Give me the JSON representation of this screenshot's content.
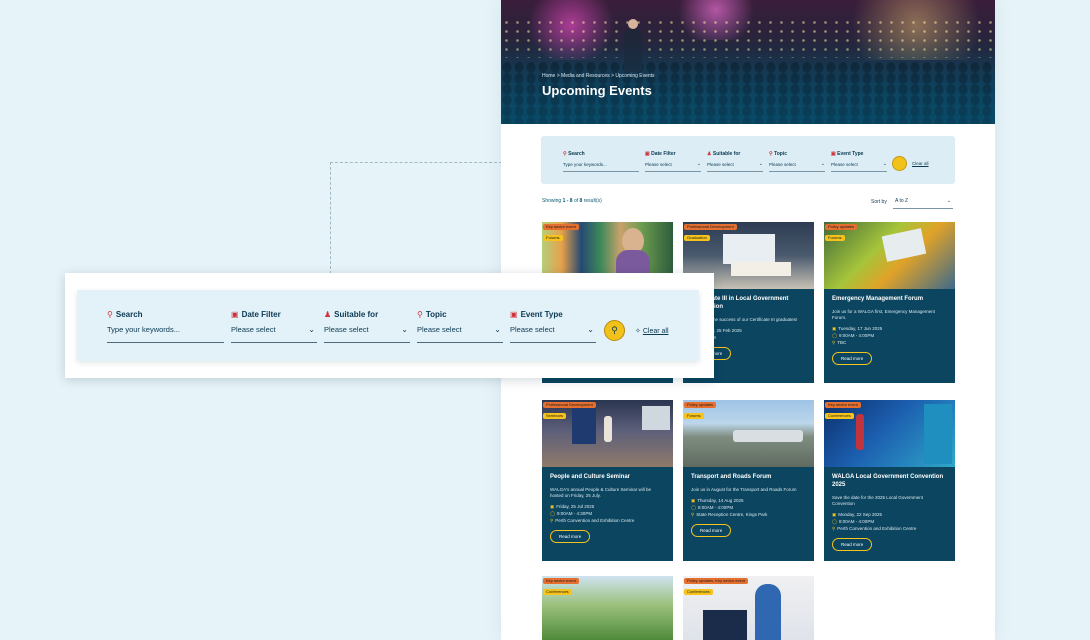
{
  "hero": {
    "breadcrumb": "Home > Media and Resources > Upcoming Events",
    "title": "Upcoming Events"
  },
  "filter": {
    "search_label": "Search",
    "search_placeholder": "Type your keywords...",
    "date_label": "Date Filter",
    "suitable_label": "Suitable for",
    "topic_label": "Topic",
    "type_label": "Event Type",
    "select_placeholder": "Please select",
    "clear_label": "Clear all"
  },
  "results": {
    "prefix": "Showing",
    "range": "1 - 8",
    "of": "of",
    "total": "8",
    "suffix": "result(s)",
    "sort_label": "Sort by",
    "sort_value": "A to Z"
  },
  "cards": [
    {
      "tag1": "Key sector event",
      "tag2": "Forums",
      "title": "",
      "desc": "",
      "date": "",
      "time": "",
      "place": "",
      "btn": "Read more"
    },
    {
      "tag1": "Professional Development",
      "tag2": "Graduation",
      "title": "Certificate III in Local Government Graduation",
      "desc": "Celebrate the success of our Certificate III graduates!",
      "date": "Tuesday, 25 Feb 2025",
      "time": "11:00AM",
      "place": "",
      "btn": "Read more"
    },
    {
      "tag1": "Policy updates",
      "tag2": "Forums",
      "title": "Emergency Management Forum",
      "desc": "Join us for a WALGA first, Emergency Management Forum.",
      "date": "Tuesday, 17 Jun 2025",
      "time": "9:00AM - 4:00PM",
      "place": "TBC",
      "btn": "Read more"
    },
    {
      "tag1": "Professional Development",
      "tag2": "Seminars",
      "title": "People and Culture Seminar",
      "desc": "WALGA's annual People & Culture Seminar will be hosted on Friday, 25 July.",
      "date": "Friday, 25 Jul 2025",
      "time": "9:00AM - 4:30PM",
      "place": "Perth Convention and Exhibition Centre",
      "btn": "Read more"
    },
    {
      "tag1": "Policy updates",
      "tag2": "Forums",
      "title": "Transport and Roads Forum",
      "desc": "Join us in August for the Transport and Roads Forum",
      "date": "Thursday, 14 Aug 2025",
      "time": "8:00AM - 4:00PM",
      "place": "State Reception Centre, Kings Park",
      "btn": "Read more"
    },
    {
      "tag1": "Key sector event",
      "tag2": "Conferences",
      "title": "WALGA Local Government Convention 2025",
      "desc": "Save the date for the 2025 Local Government Convention",
      "date": "Monday, 22 Sep 2025",
      "time": "8:00AM - 4:00PM",
      "place": "Perth Convention and Exhibition Centre",
      "btn": "Read more"
    },
    {
      "tag1": "Key sector event",
      "tag2": "Conferences"
    },
    {
      "tag1": "Policy updates, Key sector event",
      "tag2": "Conferences"
    }
  ],
  "colors": {
    "navy": "#0b4560",
    "accent": "#f3c21a",
    "tag_orange": "#e46f2f",
    "icon_red": "#d1323a",
    "background": "#e6f4f9"
  }
}
